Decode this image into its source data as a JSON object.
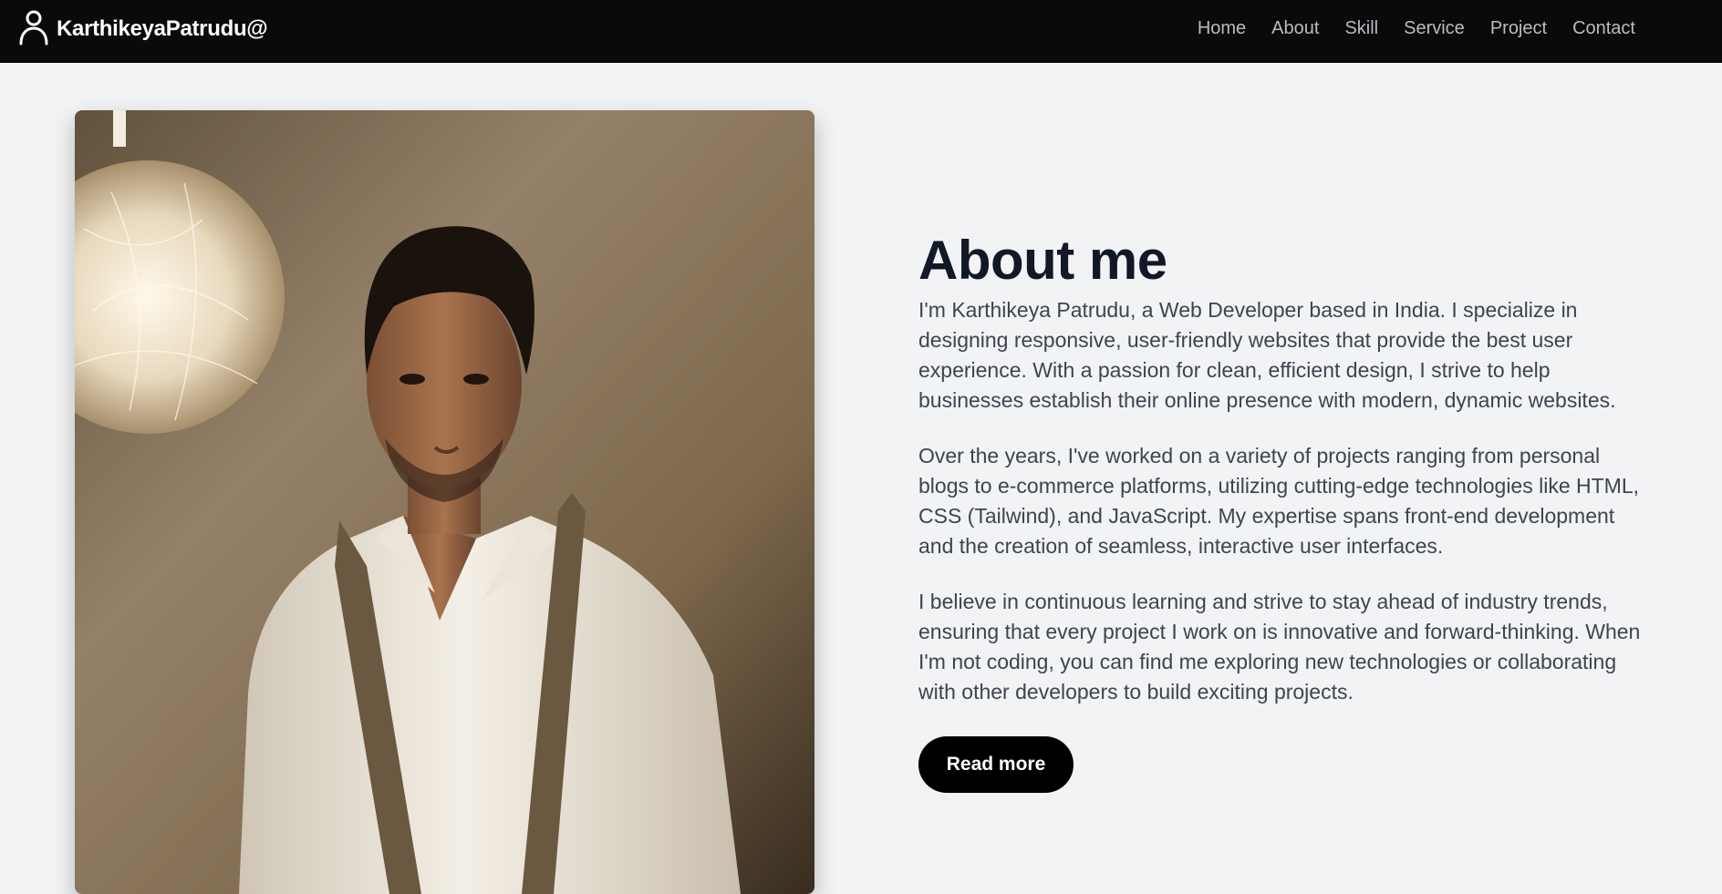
{
  "navbar": {
    "brand": "KarthikeyaPatrudu@",
    "brand_icon": "user-icon",
    "links": [
      "Home",
      "About",
      "Skill",
      "Service",
      "Project",
      "Contact"
    ]
  },
  "about": {
    "title": "About me",
    "paragraphs": [
      "I'm Karthikeya Patrudu, a Web Developer based in India. I specialize in designing responsive, user-friendly websites that provide the best user experience. With a passion for clean, efficient design, I strive to help businesses establish their online presence with modern, dynamic websites.",
      "Over the years, I've worked on a variety of projects ranging from personal blogs to e-commerce platforms, utilizing cutting-edge technologies like HTML, CSS (Tailwind), and JavaScript. My expertise spans front-end development and the creation of seamless, interactive user interfaces.",
      "I believe in continuous learning and strive to stay ahead of industry trends, ensuring that every project I work on is innovative and forward-thinking. When I'm not coding, you can find me exploring new technologies or collaborating with other developers to build exciting projects."
    ],
    "button_label": "Read more"
  },
  "colors": {
    "navbar_bg": "#0a0a0a",
    "page_bg": "#f2f3f5",
    "title": "#111827",
    "body_text": "#3f4350",
    "button_bg": "#000000"
  }
}
